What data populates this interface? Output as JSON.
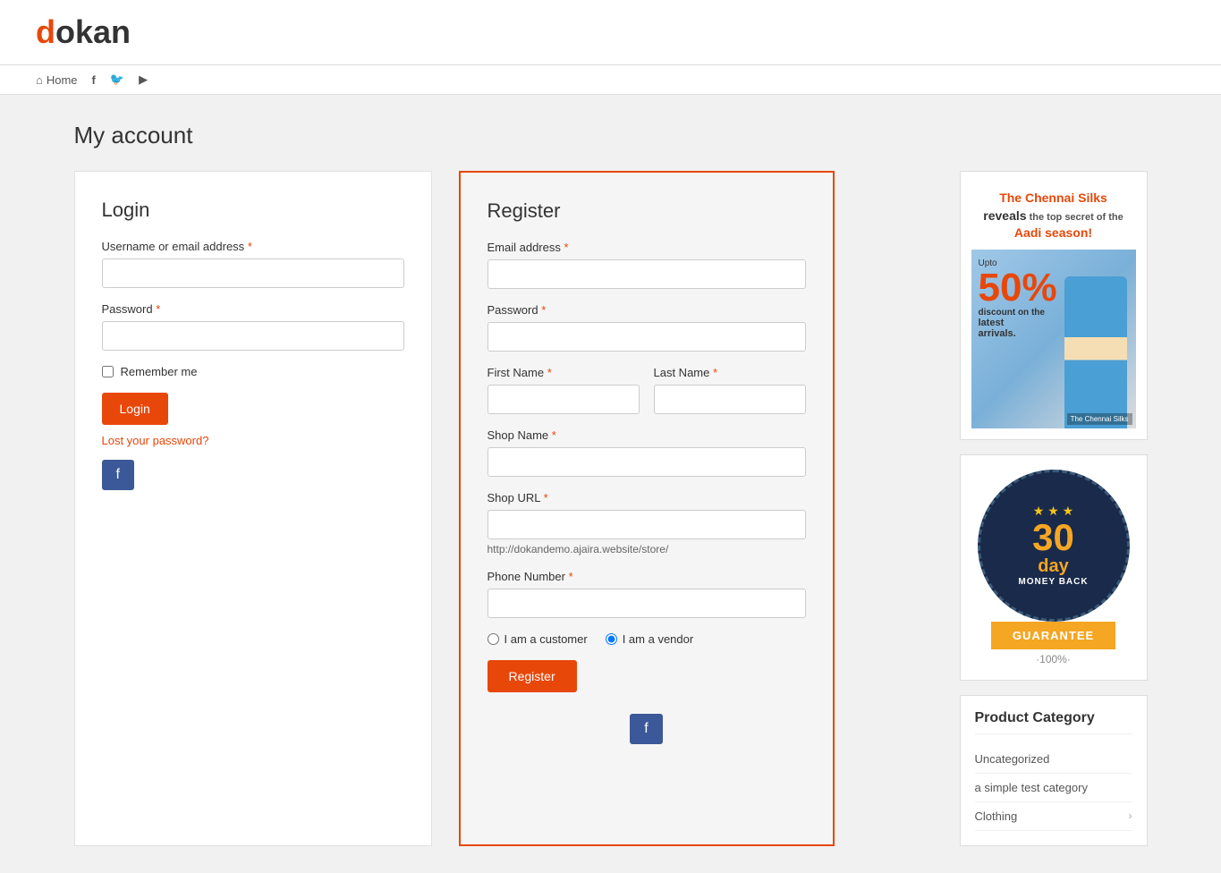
{
  "header": {
    "logo_d": "d",
    "logo_rest": "okan"
  },
  "nav": {
    "home": "Home",
    "facebook": "f",
    "twitter": "t",
    "youtube": "▶"
  },
  "page": {
    "title": "My account"
  },
  "login": {
    "section_title": "Login",
    "username_label": "Username or email address",
    "username_required": "*",
    "password_label": "Password",
    "password_required": "*",
    "remember_label": "Remember me",
    "login_btn": "Login",
    "lost_password": "Lost your password?",
    "facebook_btn": "f"
  },
  "register": {
    "section_title": "Register",
    "email_label": "Email address",
    "email_required": "*",
    "password_label": "Password",
    "password_required": "*",
    "firstname_label": "First Name",
    "firstname_required": "*",
    "lastname_label": "Last Name",
    "lastname_required": "*",
    "shopname_label": "Shop Name",
    "shopname_required": "*",
    "shopurl_label": "Shop URL",
    "shopurl_required": "*",
    "shopurl_hint": "http://dokandemo.ajaira.website/store/",
    "phone_label": "Phone Number",
    "phone_required": "*",
    "radio_customer": "I am a customer",
    "radio_vendor": "I am a vendor",
    "register_btn": "Register",
    "facebook_btn": "f"
  },
  "ad": {
    "title_line1": "The Chennai Silks",
    "title_line2": "reveals",
    "title_line3": "the top secret of the",
    "title_line4": "Aadi season!",
    "upto": "Upto",
    "percent": "50%",
    "discount": "discount on the",
    "latest": "latest arrivals.",
    "brand": "The Chennai Silks"
  },
  "guarantee": {
    "stars": "★ ★ ★",
    "days": "30",
    "day_word": "day",
    "money_back": "MONEY BACK",
    "guarantee": "GUARANTEE",
    "percent": "·100%·"
  },
  "product_category": {
    "title": "Product Category",
    "items": [
      {
        "name": "Uncategorized",
        "has_arrow": false
      },
      {
        "name": "a simple test category",
        "has_arrow": false
      },
      {
        "name": "Clothing",
        "has_arrow": true
      }
    ]
  }
}
